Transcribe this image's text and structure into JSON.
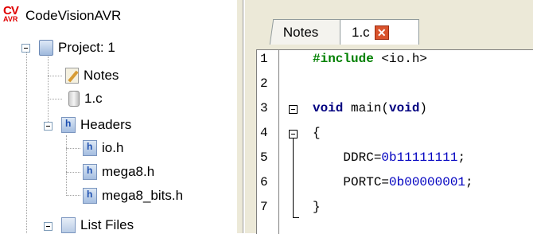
{
  "tree": {
    "root": "CodeVisionAVR",
    "logo_top": "CV",
    "logo_bottom": "AVR",
    "project": "Project: 1",
    "items": [
      {
        "label": "Notes"
      },
      {
        "label": "1.c"
      },
      {
        "label": "Headers"
      },
      {
        "label": "io.h"
      },
      {
        "label": "mega8.h"
      },
      {
        "label": "mega8_bits.h"
      },
      {
        "label": "List Files"
      }
    ]
  },
  "tabs": [
    {
      "label": "Notes"
    },
    {
      "label": "1.c"
    }
  ],
  "code": {
    "lines": [
      {
        "n": "1",
        "parts": [
          {
            "t": "#include",
            "c": "pp"
          },
          {
            "t": " <io.h>",
            "c": "plain"
          }
        ]
      },
      {
        "n": "2",
        "parts": []
      },
      {
        "n": "3",
        "parts": [
          {
            "t": "void",
            "c": "kw"
          },
          {
            "t": " main(",
            "c": "plain"
          },
          {
            "t": "void",
            "c": "kw"
          },
          {
            "t": ")",
            "c": "plain"
          }
        ]
      },
      {
        "n": "4",
        "parts": [
          {
            "t": "{",
            "c": "plain"
          }
        ]
      },
      {
        "n": "5",
        "parts": [
          {
            "t": "    DDRC=",
            "c": "plain"
          },
          {
            "t": "0b11111111",
            "c": "num"
          },
          {
            "t": ";",
            "c": "plain"
          }
        ]
      },
      {
        "n": "6",
        "parts": [
          {
            "t": "    PORTC=",
            "c": "plain"
          },
          {
            "t": "0b00000001",
            "c": "num"
          },
          {
            "t": ";",
            "c": "plain"
          }
        ]
      },
      {
        "n": "7",
        "parts": [
          {
            "t": "}",
            "c": "plain"
          }
        ]
      }
    ]
  }
}
